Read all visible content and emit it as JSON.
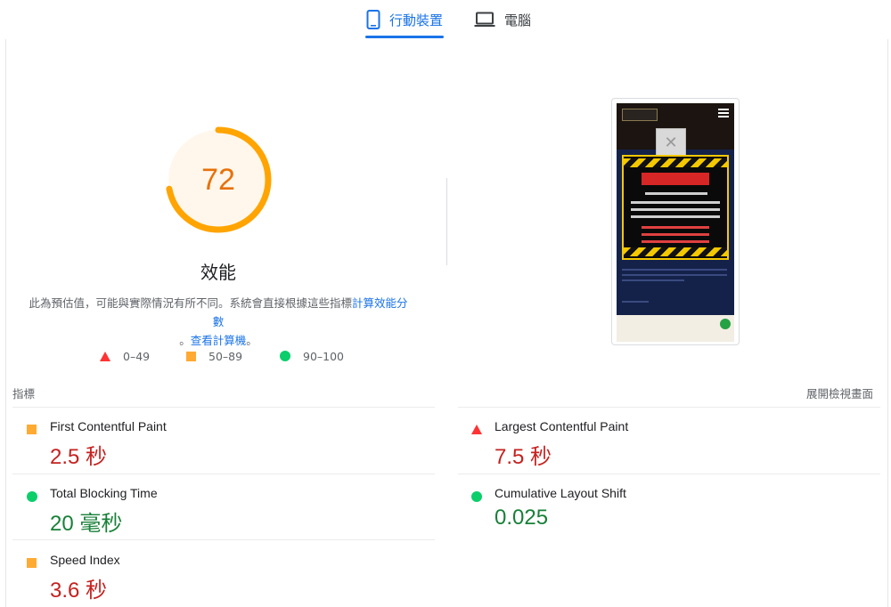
{
  "tabs": {
    "mobile": {
      "label": "行動裝置",
      "icon": "smartphone-icon",
      "active": true
    },
    "desktop": {
      "label": "電腦",
      "icon": "laptop-icon",
      "active": false
    }
  },
  "score": {
    "value": "72",
    "fraction": 0.72,
    "label": "效能",
    "color": "#ffa400"
  },
  "description": {
    "text": "此為預估值，可能與實際情況有所不同。系統會直接根據這些指標",
    "link1": "計算效能分數",
    "separator": "。",
    "link2": "查看計算機",
    "end": "。"
  },
  "legend": [
    {
      "range": "0–49",
      "shape": "triangle",
      "color": "#ff3333"
    },
    {
      "range": "50–89",
      "shape": "square",
      "color": "#ffaa33"
    },
    {
      "range": "90–100",
      "shape": "circle",
      "color": "#0cce6b"
    }
  ],
  "metrics_section": {
    "title": "指標",
    "expand_label": "展開檢視畫面"
  },
  "metrics": [
    {
      "name": "First Contentful Paint",
      "value": "2.5 秒",
      "status": "average"
    },
    {
      "name": "Largest Contentful Paint",
      "value": "7.5 秒",
      "status": "poor"
    },
    {
      "name": "Total Blocking Time",
      "value": "20 毫秒",
      "status": "good"
    },
    {
      "name": "Cumulative Layout Shift",
      "value": "0.025",
      "status": "good"
    },
    {
      "name": "Speed Index",
      "value": "3.6 秒",
      "status": "average"
    }
  ]
}
